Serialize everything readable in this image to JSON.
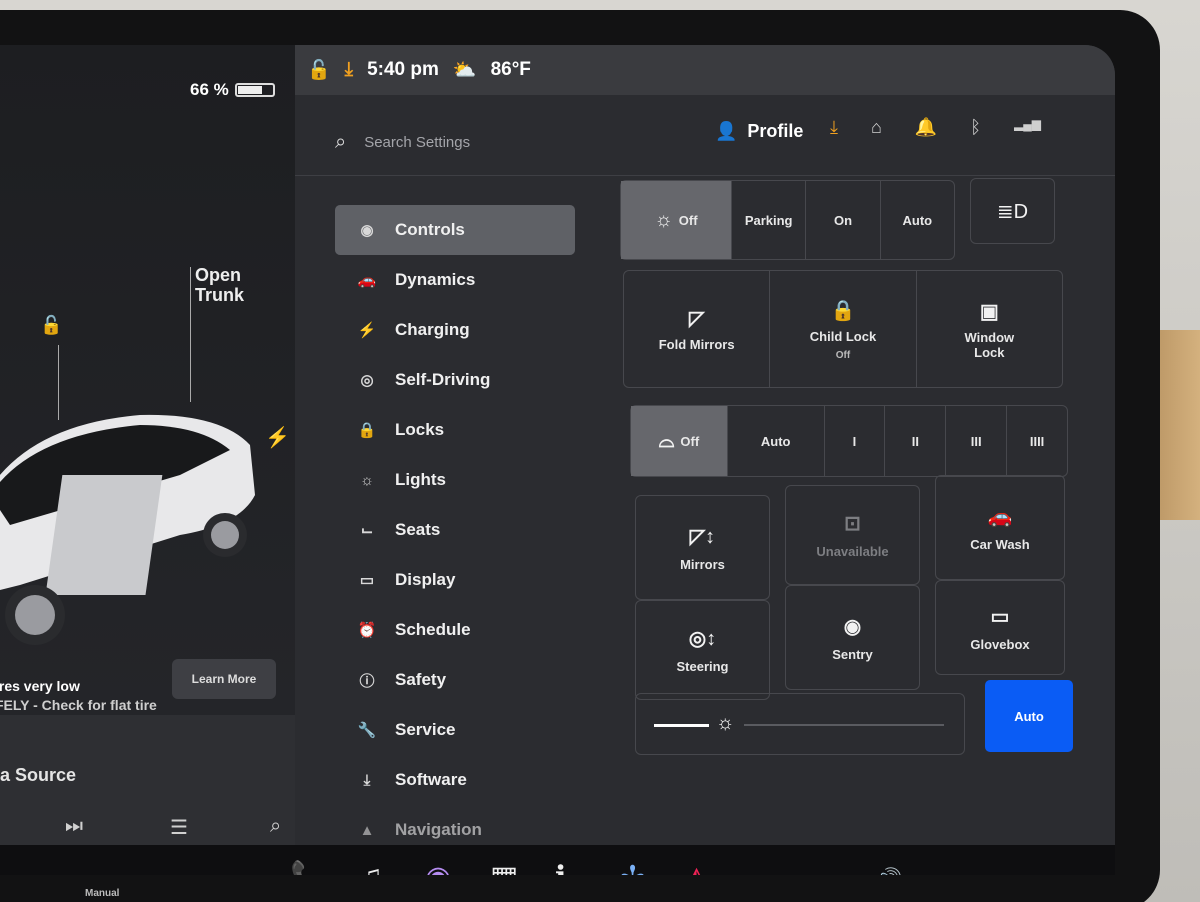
{
  "status": {
    "battery": "66 %",
    "time": "5:40 pm",
    "temp": "86°F"
  },
  "car": {
    "open_trunk": "Open\nTrunk",
    "tire_warning": "ires very low",
    "tire_warning2": "FELY - Check for flat tire",
    "learn_more": "Learn More",
    "media_source": "a Source",
    "manual": "Manual"
  },
  "search": {
    "placeholder": "Search Settings"
  },
  "profile": {
    "label": "Profile"
  },
  "nav": [
    {
      "label": "Controls",
      "icon": "toggle-icon"
    },
    {
      "label": "Dynamics",
      "icon": "car-icon"
    },
    {
      "label": "Charging",
      "icon": "bolt-icon"
    },
    {
      "label": "Self-Driving",
      "icon": "steering-wheel-icon"
    },
    {
      "label": "Locks",
      "icon": "lock-icon"
    },
    {
      "label": "Lights",
      "icon": "light-icon"
    },
    {
      "label": "Seats",
      "icon": "seat-icon"
    },
    {
      "label": "Display",
      "icon": "display-icon"
    },
    {
      "label": "Schedule",
      "icon": "clock-icon"
    },
    {
      "label": "Safety",
      "icon": "alert-icon"
    },
    {
      "label": "Service",
      "icon": "wrench-icon"
    },
    {
      "label": "Software",
      "icon": "download-icon"
    },
    {
      "label": "Navigation",
      "icon": "navigation-icon"
    }
  ],
  "lights_modes": [
    "Off",
    "Parking",
    "On",
    "Auto"
  ],
  "locks": {
    "fold_mirrors": "Fold Mirrors",
    "child_lock": "Child Lock",
    "child_lock_state": "Off",
    "window_lock": "Window\nLock"
  },
  "wiper_modes": [
    "Off",
    "Auto",
    "I",
    "II",
    "III",
    "IIII"
  ],
  "tiles": {
    "mirrors": "Mirrors",
    "unavailable": "Unavailable",
    "car_wash": "Car Wash",
    "steering": "Steering",
    "sentry": "Sentry",
    "glovebox": "Glovebox",
    "auto": "Auto"
  },
  "colors": {
    "accent": "#0a5cf5",
    "download": "#f0a020"
  }
}
